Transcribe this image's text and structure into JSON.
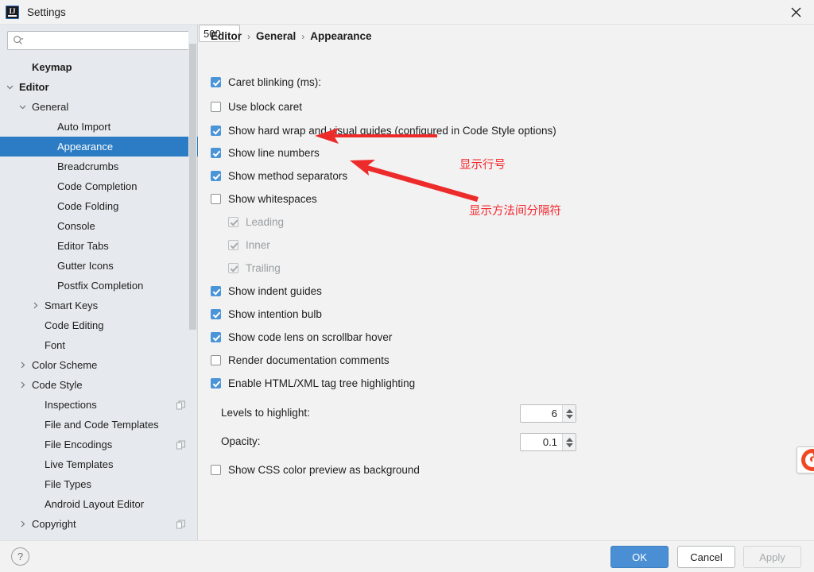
{
  "window": {
    "title": "Settings",
    "app_icon": "intellij-idea-icon",
    "close_icon": "close-icon"
  },
  "search": {
    "placeholder": "",
    "value": "",
    "icon": "search-icon"
  },
  "sidebar": {
    "items": [
      {
        "label": "Keymap",
        "indent": 1,
        "twisty": "none",
        "bold": true,
        "selected": false,
        "badge": false
      },
      {
        "label": "Editor",
        "indent": 0,
        "twisty": "expanded",
        "bold": true,
        "selected": false,
        "badge": false
      },
      {
        "label": "General",
        "indent": 1,
        "twisty": "expanded",
        "bold": false,
        "selected": false,
        "badge": false
      },
      {
        "label": "Auto Import",
        "indent": 3,
        "twisty": "none",
        "bold": false,
        "selected": false,
        "badge": false
      },
      {
        "label": "Appearance",
        "indent": 3,
        "twisty": "none",
        "bold": false,
        "selected": true,
        "badge": false
      },
      {
        "label": "Breadcrumbs",
        "indent": 3,
        "twisty": "none",
        "bold": false,
        "selected": false,
        "badge": false
      },
      {
        "label": "Code Completion",
        "indent": 3,
        "twisty": "none",
        "bold": false,
        "selected": false,
        "badge": false
      },
      {
        "label": "Code Folding",
        "indent": 3,
        "twisty": "none",
        "bold": false,
        "selected": false,
        "badge": false
      },
      {
        "label": "Console",
        "indent": 3,
        "twisty": "none",
        "bold": false,
        "selected": false,
        "badge": false
      },
      {
        "label": "Editor Tabs",
        "indent": 3,
        "twisty": "none",
        "bold": false,
        "selected": false,
        "badge": false
      },
      {
        "label": "Gutter Icons",
        "indent": 3,
        "twisty": "none",
        "bold": false,
        "selected": false,
        "badge": false
      },
      {
        "label": "Postfix Completion",
        "indent": 3,
        "twisty": "none",
        "bold": false,
        "selected": false,
        "badge": false
      },
      {
        "label": "Smart Keys",
        "indent": 2,
        "twisty": "collapsed",
        "bold": false,
        "selected": false,
        "badge": false
      },
      {
        "label": "Code Editing",
        "indent": 2,
        "twisty": "none",
        "bold": false,
        "selected": false,
        "badge": false
      },
      {
        "label": "Font",
        "indent": 2,
        "twisty": "none",
        "bold": false,
        "selected": false,
        "badge": false
      },
      {
        "label": "Color Scheme",
        "indent": 1,
        "twisty": "collapsed",
        "bold": false,
        "selected": false,
        "badge": false
      },
      {
        "label": "Code Style",
        "indent": 1,
        "twisty": "collapsed",
        "bold": false,
        "selected": false,
        "badge": false
      },
      {
        "label": "Inspections",
        "indent": 2,
        "twisty": "none",
        "bold": false,
        "selected": false,
        "badge": true
      },
      {
        "label": "File and Code Templates",
        "indent": 2,
        "twisty": "none",
        "bold": false,
        "selected": false,
        "badge": false
      },
      {
        "label": "File Encodings",
        "indent": 2,
        "twisty": "none",
        "bold": false,
        "selected": false,
        "badge": true
      },
      {
        "label": "Live Templates",
        "indent": 2,
        "twisty": "none",
        "bold": false,
        "selected": false,
        "badge": false
      },
      {
        "label": "File Types",
        "indent": 2,
        "twisty": "none",
        "bold": false,
        "selected": false,
        "badge": false
      },
      {
        "label": "Android Layout Editor",
        "indent": 2,
        "twisty": "none",
        "bold": false,
        "selected": false,
        "badge": false
      },
      {
        "label": "Copyright",
        "indent": 1,
        "twisty": "collapsed",
        "bold": false,
        "selected": false,
        "badge": true
      }
    ]
  },
  "main": {
    "breadcrumb": [
      "Editor",
      "General",
      "Appearance"
    ],
    "breadcrumb_separator": "›",
    "settings": [
      {
        "label": "Caret blinking (ms):",
        "checked": true,
        "disabled": false,
        "indent": 0
      },
      {
        "label": "Use block caret",
        "checked": false,
        "disabled": false,
        "indent": 0
      },
      {
        "label": "Show hard wrap and visual guides (configured in Code Style options)",
        "checked": true,
        "disabled": false,
        "indent": 0
      },
      {
        "label": "Show line numbers",
        "checked": true,
        "disabled": false,
        "indent": 0
      },
      {
        "label": "Show method separators",
        "checked": true,
        "disabled": false,
        "indent": 0
      },
      {
        "label": "Show whitespaces",
        "checked": false,
        "disabled": false,
        "indent": 0
      },
      {
        "label": "Leading",
        "checked": true,
        "disabled": true,
        "indent": 1
      },
      {
        "label": "Inner",
        "checked": true,
        "disabled": true,
        "indent": 1
      },
      {
        "label": "Trailing",
        "checked": true,
        "disabled": true,
        "indent": 1
      },
      {
        "label": "Show indent guides",
        "checked": true,
        "disabled": false,
        "indent": 0
      },
      {
        "label": "Show intention bulb",
        "checked": true,
        "disabled": false,
        "indent": 0
      },
      {
        "label": "Show code lens on scrollbar hover",
        "checked": true,
        "disabled": false,
        "indent": 0
      },
      {
        "label": "Render documentation comments",
        "checked": false,
        "disabled": false,
        "indent": 0
      },
      {
        "label": "Enable HTML/XML tag tree highlighting",
        "checked": true,
        "disabled": false,
        "indent": 0
      },
      {
        "label": "Show CSS color preview as background",
        "checked": false,
        "disabled": false,
        "indent": 0
      }
    ],
    "caret_blinking_value": "500",
    "levels_label": "Levels to highlight:",
    "levels_value": "6",
    "opacity_label": "Opacity:",
    "opacity_value": "0.1"
  },
  "annotations": [
    {
      "text": "显示行号",
      "color": "#f5262c"
    },
    {
      "text": "显示方法间分隔符",
      "color": "#f5262c"
    }
  ],
  "footer": {
    "help_label": "?",
    "ok_label": "OK",
    "cancel_label": "Cancel",
    "apply_label": "Apply"
  },
  "colors": {
    "accent": "#2b7cc4",
    "checkbox_on": "#4a94d8",
    "annotation_red": "#f5262c",
    "sidebar_bg": "#e6eaee",
    "panel_bg": "#f2f2f2"
  }
}
